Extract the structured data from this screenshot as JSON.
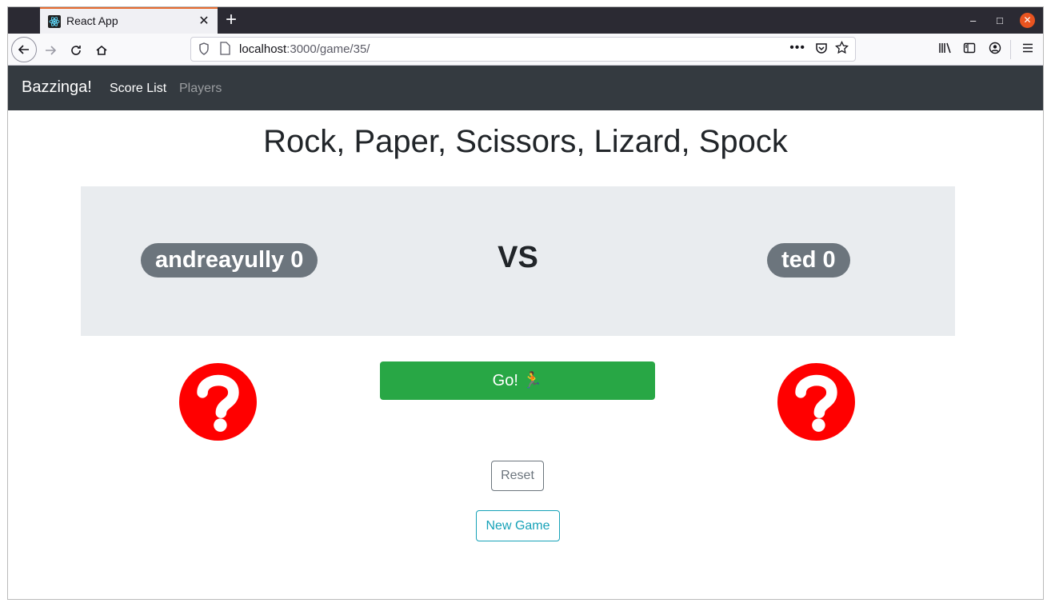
{
  "browser": {
    "tab_title": "React App",
    "tab_close": "✕",
    "new_tab": "+",
    "url_host": "localhost",
    "url_rest": ":3000/game/35/",
    "window_controls": {
      "minimize": "–",
      "maximize": "□",
      "close": "✕"
    },
    "accent_color": "#e66b2f"
  },
  "app_nav": {
    "brand": "Bazzinga!",
    "links": [
      {
        "label": "Score List",
        "active": true
      },
      {
        "label": "Players",
        "active": false
      }
    ]
  },
  "game": {
    "title": "Rock, Paper, Scissors, Lizard, Spock",
    "player1": {
      "name": "andreayully",
      "score": "0",
      "label": "andreayully 0"
    },
    "vs_label": "VS",
    "player2": {
      "name": "ted",
      "score": "0",
      "label": "ted 0"
    },
    "player1_choice_icon": "question-circle-icon",
    "player2_choice_icon": "question-circle-icon",
    "go_label": "Go! 🏃",
    "reset_label": "Reset",
    "new_game_label": "New Game"
  },
  "colors": {
    "navbar": "#343a40",
    "jumbotron": "#e9ecef",
    "badge": "#6c757d",
    "go_button": "#28a745",
    "reset": "#6c757d",
    "new_game": "#17a2b8",
    "question": "#ff0000"
  }
}
